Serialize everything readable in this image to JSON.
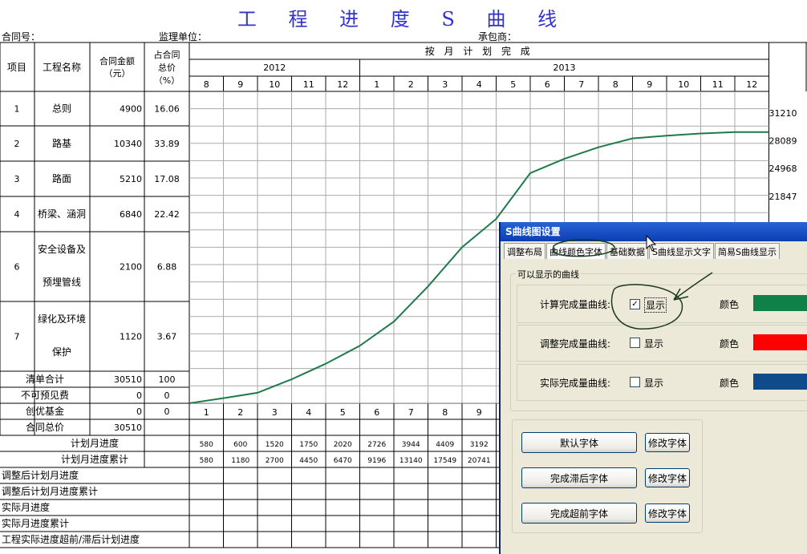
{
  "title": "工 程 进 度 S 曲 线",
  "meta": {
    "contract_no": "合同号：",
    "supervisor": "监理单位：",
    "contractor": "承包商："
  },
  "table": {
    "hdr_item": "项目",
    "hdr_name": "工程名称",
    "hdr_amount": [
      "合同金额",
      "（元）"
    ],
    "hdr_pct": [
      "占合同",
      "总价",
      "（%）"
    ],
    "hdr_plan": "按 月 计 划 完 成",
    "years": [
      "2012",
      "2013"
    ],
    "months": [
      "8",
      "9",
      "10",
      "11",
      "12",
      "1",
      "2",
      "3",
      "4",
      "5",
      "6",
      "7",
      "8",
      "9",
      "10",
      "11",
      "12"
    ],
    "rows": [
      {
        "id": "1",
        "name": [
          "总则"
        ],
        "amount": "4900",
        "pct": "16.06"
      },
      {
        "id": "2",
        "name": [
          "路基"
        ],
        "amount": "10340",
        "pct": "33.89"
      },
      {
        "id": "3",
        "name": [
          "路面"
        ],
        "amount": "5210",
        "pct": "17.08"
      },
      {
        "id": "4",
        "name": [
          "桥梁、涵洞"
        ],
        "amount": "6840",
        "pct": "22.42"
      },
      {
        "id": "6",
        "name": [
          "安全设备及",
          "预埋管线"
        ],
        "amount": "2100",
        "pct": "6.88"
      },
      {
        "id": "7",
        "name": [
          "绿化及环境",
          "保护"
        ],
        "amount": "1120",
        "pct": "3.67"
      }
    ],
    "summary": [
      {
        "label": "清单合计",
        "amount": "30510",
        "pct": "100"
      },
      {
        "label": "不可预见费",
        "amount": "0",
        "pct": "0"
      },
      {
        "label": "创优基金",
        "amount": "0",
        "pct": "0"
      },
      {
        "label": "合同总价",
        "amount": "30510",
        "pct": ""
      }
    ],
    "period_numbers": [
      "1",
      "2",
      "3",
      "4",
      "5",
      "6",
      "7",
      "8",
      "9"
    ],
    "plan_month_label": "计划月进度",
    "plan_month": [
      "580",
      "600",
      "1520",
      "1750",
      "2020",
      "2726",
      "3944",
      "4409",
      "3192"
    ],
    "plan_cum_label": "计划月进度累计",
    "plan_cum": [
      "580",
      "1180",
      "2700",
      "4450",
      "6470",
      "9196",
      "13140",
      "17549",
      "20741"
    ],
    "bottom_rows": [
      "调整后计划月进度",
      "调整后计划月进度累计",
      "实际月进度",
      "实际月进度累计",
      "工程实际进度超前/滞后计划进度"
    ]
  },
  "y_axis_labels": [
    "31210",
    "28089",
    "24968",
    "21847"
  ],
  "chart_data": {
    "type": "line",
    "x": [
      0,
      1,
      2,
      3,
      4,
      5,
      6,
      7,
      8,
      9,
      10,
      11,
      12,
      13,
      14,
      15,
      16,
      17
    ],
    "series": [
      {
        "values": [
          0,
          580,
          1180,
          2700,
          4450,
          6470,
          9196,
          13140,
          17549,
          20741,
          25900,
          27500,
          28800,
          29800,
          30100,
          30350,
          30510,
          30510
        ]
      }
    ],
    "ylim": [
      0,
      31210
    ],
    "color": "#1f7a4a"
  },
  "dialog": {
    "title": "S曲线图设置",
    "tabs": [
      "调整布局",
      "曲线颜色字体",
      "基础数据",
      "S曲线显示文字",
      "简易S曲线显示"
    ],
    "active_tab": 1,
    "group_title": "可以显示的曲线",
    "curves": [
      {
        "label": "计算完成量曲线:",
        "checked": true,
        "color": "#0f8048"
      },
      {
        "label": "调整完成量曲线:",
        "checked": false,
        "color": "#ff0000"
      },
      {
        "label": "实际完成量曲线:",
        "checked": false,
        "color": "#0f4a8a"
      }
    ],
    "show_label": "显示",
    "color_label": "颜色",
    "check_mark": "✓",
    "font_rows": [
      {
        "name": "默认字体",
        "action": "修改字体"
      },
      {
        "name": "完成滞后字体",
        "action": "修改字体"
      },
      {
        "name": "完成超前字体",
        "action": "修改字体"
      }
    ]
  }
}
